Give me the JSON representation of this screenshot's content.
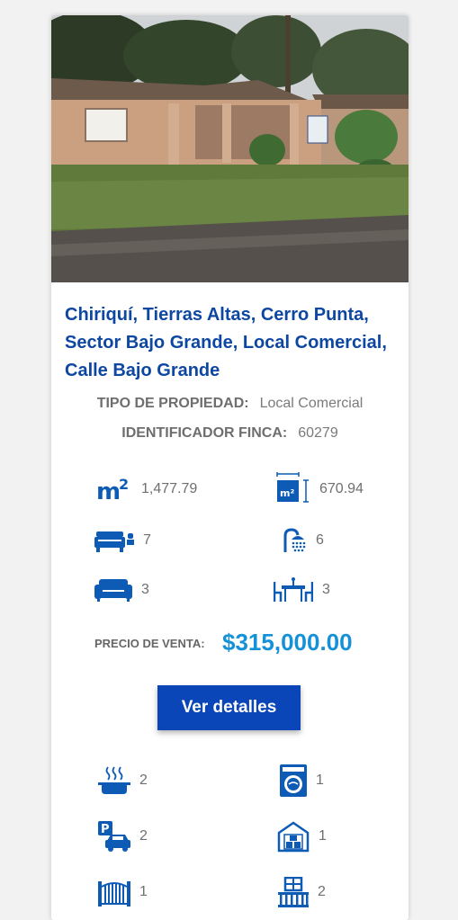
{
  "listing": {
    "title": "Chiriquí, Tierras Altas, Cerro Punta, Sector Bajo Grande, Local Comercial, Calle Bajo Grande",
    "property_type_label": "TIPO DE PROPIEDAD:",
    "property_type_value": "Local Comercial",
    "finca_label": "IDENTIFICADOR FINCA:",
    "finca_value": "60279",
    "features": {
      "land_area": "1,477.79",
      "built_area": "670.94",
      "bedrooms": "7",
      "bathrooms": "6",
      "living_rooms": "3",
      "dining_rooms": "3"
    },
    "price_label": "PRECIO DE VENTA:",
    "price_value": "$315,000.00",
    "details_button": "Ver detalles",
    "extras": {
      "kitchens": "2",
      "laundry": "1",
      "parking": "2",
      "storage": "1",
      "gates": "1",
      "balconies": "2"
    }
  },
  "icons": {
    "land_area": "m2-icon",
    "built_area": "built-area-icon",
    "bedrooms": "bed-icon",
    "bathrooms": "shower-icon",
    "living_rooms": "sofa-icon",
    "dining_rooms": "dining-table-icon",
    "kitchens": "cooking-pot-icon",
    "laundry": "washing-machine-icon",
    "parking": "parking-icon",
    "storage": "storage-garage-icon",
    "gates": "gate-icon",
    "balconies": "balcony-icon"
  },
  "colors": {
    "icon_blue": "#0d5bb5",
    "title_blue": "#0d47a1",
    "price_blue": "#1591d8",
    "button_blue": "#0a46b8"
  }
}
